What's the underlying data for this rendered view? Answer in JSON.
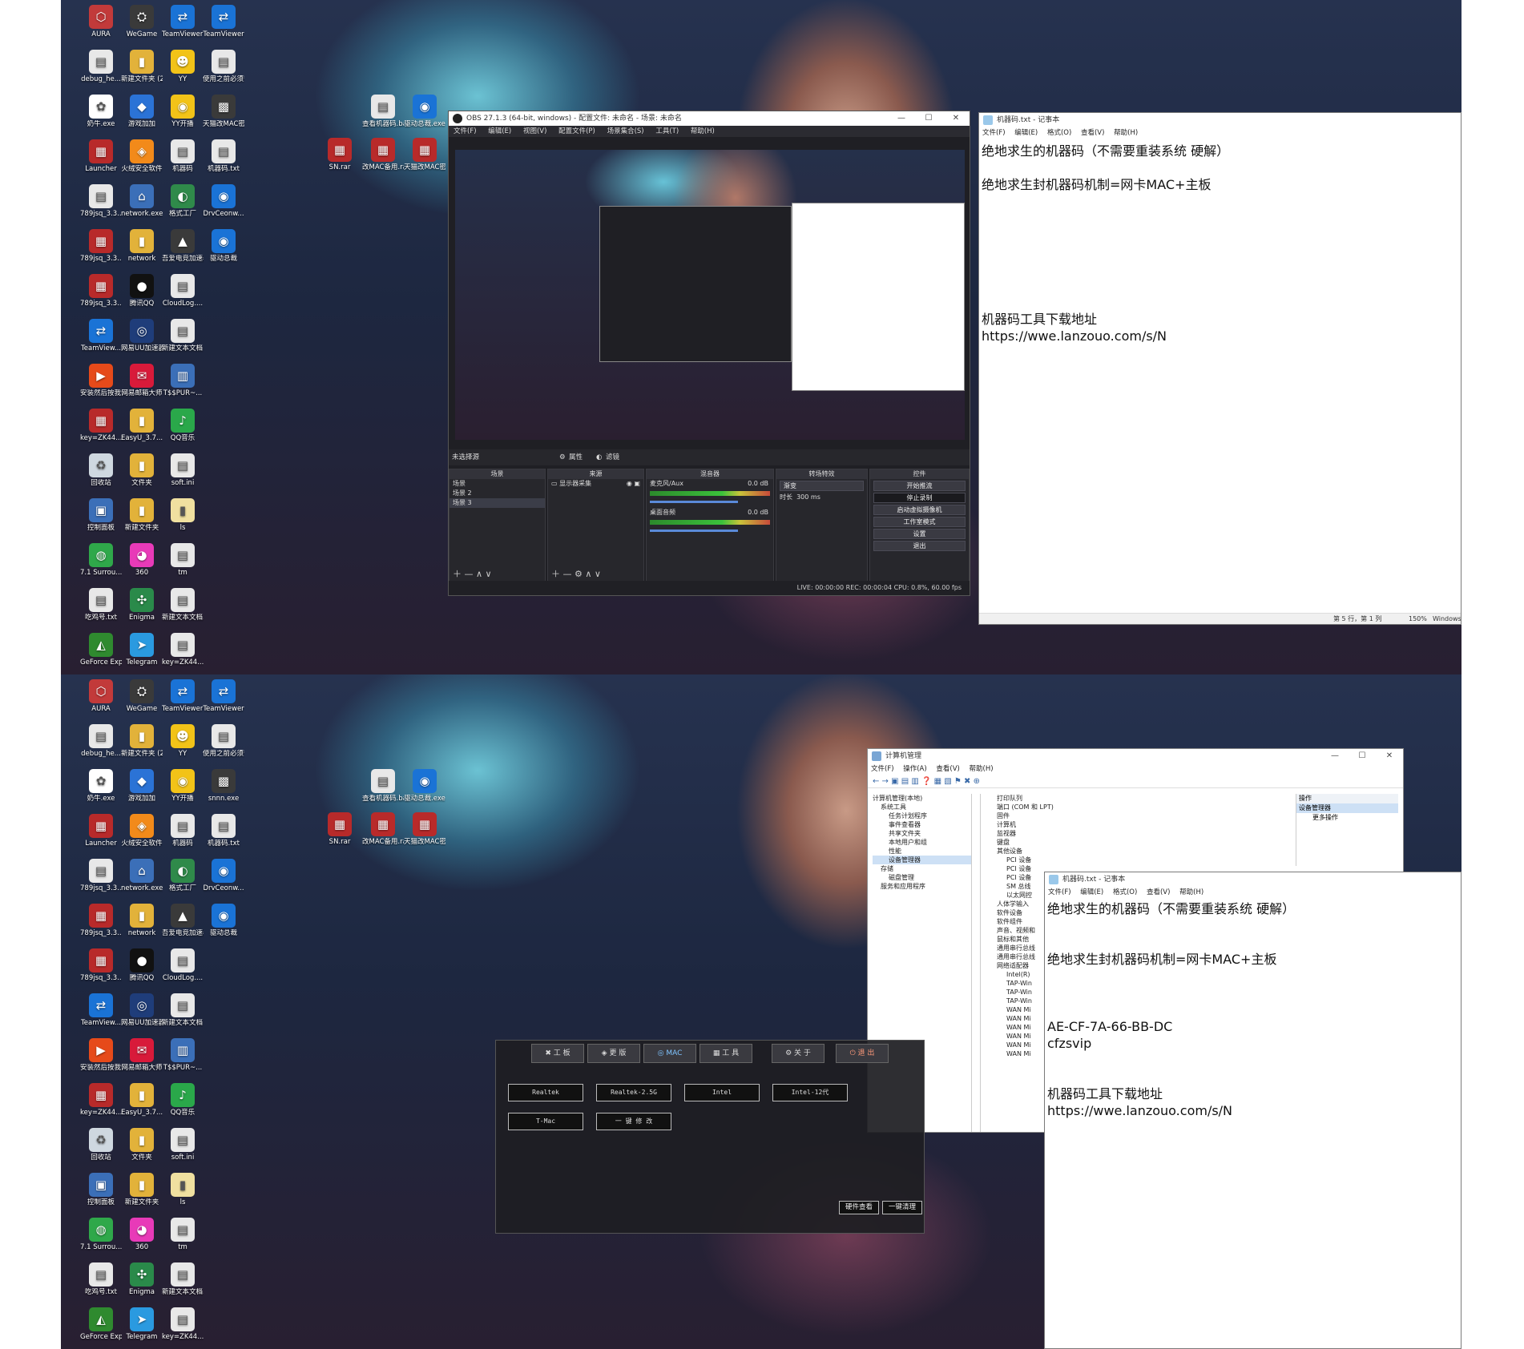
{
  "desktop_icons": [
    {
      "label": "AURA",
      "glyph": "⬡",
      "color": "#c23a3a"
    },
    {
      "label": "WeGame",
      "glyph": "⛭",
      "color": "#3a3a3a"
    },
    {
      "label": "TeamViewer 远程协助软...",
      "glyph": "⇄",
      "color": "#1a73d6"
    },
    {
      "label": "TeamViewer",
      "glyph": "⇄",
      "color": "#1a73d6"
    },
    {
      "label": "debug_he...",
      "glyph": "▤",
      "color": "#e8e8e8"
    },
    {
      "label": "新建文件夹 (2)",
      "glyph": "▮",
      "color": "#e2b23a"
    },
    {
      "label": "YY",
      "glyph": "☻",
      "color": "#f2c318"
    },
    {
      "label": "使用之前必须安装我...",
      "glyph": "▤",
      "color": "#e8e8e8"
    },
    {
      "label": "奶牛.exe",
      "glyph": "✿",
      "color": "#ffffff"
    },
    {
      "label": "游戏加加",
      "glyph": "◆",
      "color": "#2b73d6"
    },
    {
      "label": "YY开播",
      "glyph": "◉",
      "color": "#f2c318"
    },
    {
      "label": "天猫改MAC密码是cfz...",
      "glyph": "▩",
      "color": "#3a3a3a"
    },
    {
      "label": "Launcher",
      "glyph": "▦",
      "color": "#b82a2a"
    },
    {
      "label": "火绒安全软件",
      "glyph": "◈",
      "color": "#f28a1a"
    },
    {
      "label": "机器码",
      "glyph": "▤",
      "color": "#e8e8e8"
    },
    {
      "label": "机器码.txt",
      "glyph": "▤",
      "color": "#e8e8e8"
    },
    {
      "label": "789jsq_3.3...",
      "glyph": "▤",
      "color": "#e8e8e8"
    },
    {
      "label": "network.exe",
      "glyph": "⌂",
      "color": "#3b6fb8"
    },
    {
      "label": "格式工厂",
      "glyph": "◐",
      "color": "#2f8a4a"
    },
    {
      "label": "DrvCeonw...",
      "glyph": "◉",
      "color": "#1a73d6"
    },
    {
      "label": "789jsq_3.3... (1).zip",
      "glyph": "▦",
      "color": "#b82a2a"
    },
    {
      "label": "network",
      "glyph": "▮",
      "color": "#e2b23a"
    },
    {
      "label": "吾爱电竞加速器",
      "glyph": "▲",
      "color": "#3a3a3a"
    },
    {
      "label": "驱动总裁",
      "glyph": "◉",
      "color": "#1a73d6"
    },
    {
      "label": "789jsq_3.3...",
      "glyph": "▦",
      "color": "#b82a2a"
    },
    {
      "label": "腾讯QQ",
      "glyph": "●",
      "color": "#111111"
    },
    {
      "label": "CloudLog....",
      "glyph": "▤",
      "color": "#e8e8e8"
    },
    {
      "label": "",
      "glyph": "",
      "color": "transparent"
    },
    {
      "label": "TeamView...",
      "glyph": "⇄",
      "color": "#1a73d6"
    },
    {
      "label": "网易UU加速器",
      "glyph": "◎",
      "color": "#1f3d7a"
    },
    {
      "label": "新建文本文档 (3).txt",
      "glyph": "▤",
      "color": "#e8e8e8"
    },
    {
      "label": "",
      "glyph": "",
      "color": "transparent"
    },
    {
      "label": "安装然后按我识别码.exe",
      "glyph": "▶",
      "color": "#e64a1a"
    },
    {
      "label": "网易邮箱大师",
      "glyph": "✉",
      "color": "#d81a3a"
    },
    {
      "label": "T$$PUR~...",
      "glyph": "▥",
      "color": "#3b6fb8"
    },
    {
      "label": "",
      "glyph": "",
      "color": "transparent"
    },
    {
      "label": "key=ZK44...",
      "glyph": "▦",
      "color": "#b82a2a"
    },
    {
      "label": "EasyU_3.7...",
      "glyph": "▮",
      "color": "#e2b23a"
    },
    {
      "label": "QQ音乐",
      "glyph": "♪",
      "color": "#2aa84a"
    },
    {
      "label": "",
      "glyph": "",
      "color": "transparent"
    },
    {
      "label": "回收站",
      "glyph": "♻",
      "color": "#cfd8e0"
    },
    {
      "label": "文件夹",
      "glyph": "▮",
      "color": "#e2b23a"
    },
    {
      "label": "soft.ini",
      "glyph": "▤",
      "color": "#e8e8e8"
    },
    {
      "label": "",
      "glyph": "",
      "color": "transparent"
    },
    {
      "label": "控制面板",
      "glyph": "▣",
      "color": "#3b6fb8"
    },
    {
      "label": "新建文件夹",
      "glyph": "▮",
      "color": "#e2b23a"
    },
    {
      "label": "ls",
      "glyph": "▮",
      "color": "#f0e0a0"
    },
    {
      "label": "",
      "glyph": "",
      "color": "transparent"
    },
    {
      "label": "7.1 Surrou...",
      "glyph": "◍",
      "color": "#2fa84a"
    },
    {
      "label": "360",
      "glyph": "◕",
      "color": "#e83ab8"
    },
    {
      "label": "tm",
      "glyph": "▤",
      "color": "#e8e8e8"
    },
    {
      "label": "",
      "glyph": "",
      "color": "transparent"
    },
    {
      "label": "吃鸡号.txt",
      "glyph": "▤",
      "color": "#e8e8e8"
    },
    {
      "label": "Enigma",
      "glyph": "✣",
      "color": "#2a8a4a"
    },
    {
      "label": "新建文本文档.txt",
      "glyph": "▤",
      "color": "#e8e8e8"
    },
    {
      "label": "",
      "glyph": "",
      "color": "transparent"
    },
    {
      "label": "GeForce Experience",
      "glyph": "◭",
      "color": "#2f8a2f"
    },
    {
      "label": "Telegram",
      "glyph": "➤",
      "color": "#2a9ae0"
    },
    {
      "label": "key=ZK44...",
      "glyph": "▤",
      "color": "#e8e8e8"
    }
  ],
  "extra_icons_top": [
    {
      "label": "查看机器码.bat",
      "glyph": "▤",
      "color": "#e8e8e8"
    },
    {
      "label": "驱动总裁.exe",
      "glyph": "◉",
      "color": "#1a73d6"
    },
    {
      "label": "SN.rar",
      "glyph": "▦",
      "color": "#b82a2a"
    },
    {
      "label": "改MAC备用.rar",
      "glyph": "▦",
      "color": "#b82a2a"
    },
    {
      "label": "天猫改MAC密码是cfz...",
      "glyph": "▦",
      "color": "#b82a2a"
    }
  ],
  "bottom_overrides": {
    "icon_11": "snnn.exe",
    "icon_27": "SN"
  },
  "obs": {
    "title": "OBS 27.1.3 (64-bit, windows) - 配置文件: 未命名 - 场景: 未命名",
    "menu": [
      "文件(F)",
      "编辑(E)",
      "视图(V)",
      "配置文件(P)",
      "场景集合(S)",
      "工具(T)",
      "帮助(H)"
    ],
    "no_source": "未选择源",
    "props": "属性",
    "filters": "滤镜",
    "scenes_header": "场景",
    "scenes": [
      "场景",
      "场景 2",
      "场景 3"
    ],
    "sources_header": "来源",
    "sources": [
      "显示器采集"
    ],
    "mixer_header": "混音器",
    "mixer": [
      {
        "name": "麦克风/Aux",
        "level": "0.0 dB"
      },
      {
        "name": "桌面音频",
        "level": "0.0 dB"
      }
    ],
    "transitions_header": "转场特效",
    "transition": "渐变",
    "duration_label": "时长",
    "duration": "300 ms",
    "controls_header": "控件",
    "controls": [
      "开始推流",
      "停止录制",
      "启动虚拟摄像机",
      "工作室模式",
      "设置",
      "退出"
    ],
    "status": "LIVE: 00:00:00    REC: 00:00:04    CPU: 0.8%, 60.00 fps"
  },
  "notepad_top": {
    "title": "机器码.txt - 记事本",
    "menu": [
      "文件(F)",
      "编辑(E)",
      "格式(O)",
      "查看(V)",
      "帮助(H)"
    ],
    "lines": [
      "绝地求生的机器码（不需要重装系统 硬解）",
      "",
      "绝地求生封机器码机制=网卡MAC+主板",
      "",
      "",
      "",
      "",
      "",
      "机器码工具下载地址",
      "https://wwe.lanzouo.com/s/N"
    ],
    "status_pos": "第 5 行，第 1 列",
    "status_zoom": "150%",
    "status_eol": "Windows"
  },
  "compmgmt": {
    "title": "计算机管理",
    "menu": [
      "文件(F)",
      "操作(A)",
      "查看(V)",
      "帮助(H)"
    ],
    "tree": [
      "计算机管理(本地)",
      "系统工具",
      "任务计划程序",
      "事件查看器",
      "共享文件夹",
      "本地用户和组",
      "性能",
      "设备管理器",
      "存储",
      "磁盘管理",
      "服务和应用程序"
    ],
    "devices": [
      "打印队列",
      "端口 (COM 和 LPT)",
      "固件",
      "计算机",
      "监视器",
      "键盘",
      "其他设备",
      "PCI 设备",
      "PCI 设备",
      "PCI 设备",
      "SM 总线",
      "以太网控",
      "人体学输入",
      "软件设备",
      "软件组件",
      "声音、视频和",
      "鼠标和其他",
      "通用串行总线",
      "通用串行总线",
      "网络适配器",
      "Intel(R)",
      "TAP-Win",
      "TAP-Win",
      "TAP-Win",
      "WAN Mi",
      "WAN Mi",
      "WAN Mi",
      "WAN Mi",
      "WAN Mi",
      "WAN Mi"
    ],
    "actions_header": "操作",
    "actions_item": "设备管理器",
    "actions_more": "更多操作"
  },
  "notepad_bot": {
    "title": "机器码.txt - 记事本",
    "menu": [
      "文件(F)",
      "编辑(E)",
      "格式(O)",
      "查看(V)",
      "帮助(H)"
    ],
    "lines": [
      "绝地求生的机器码（不需要重装系统 硬解）",
      "",
      "绝地求生封机器码机制=网卡MAC+主板",
      "",
      "",
      "AE-CF-7A-66-BB-DC",
      "cfzsvip",
      "",
      "机器码工具下载地址",
      "https://wwe.lanzouo.com/s/N"
    ]
  },
  "tool": {
    "tabs": [
      "工 板",
      "更 版",
      "MAC",
      "工 具",
      "关 于",
      "退 出"
    ],
    "buttons": [
      "Realtek",
      "Realtek-2.5G",
      "Intel",
      "Intel-12代",
      "T-Mac",
      "一 键 修 改"
    ],
    "bottom": [
      "硬件查看",
      "一键清理"
    ]
  }
}
